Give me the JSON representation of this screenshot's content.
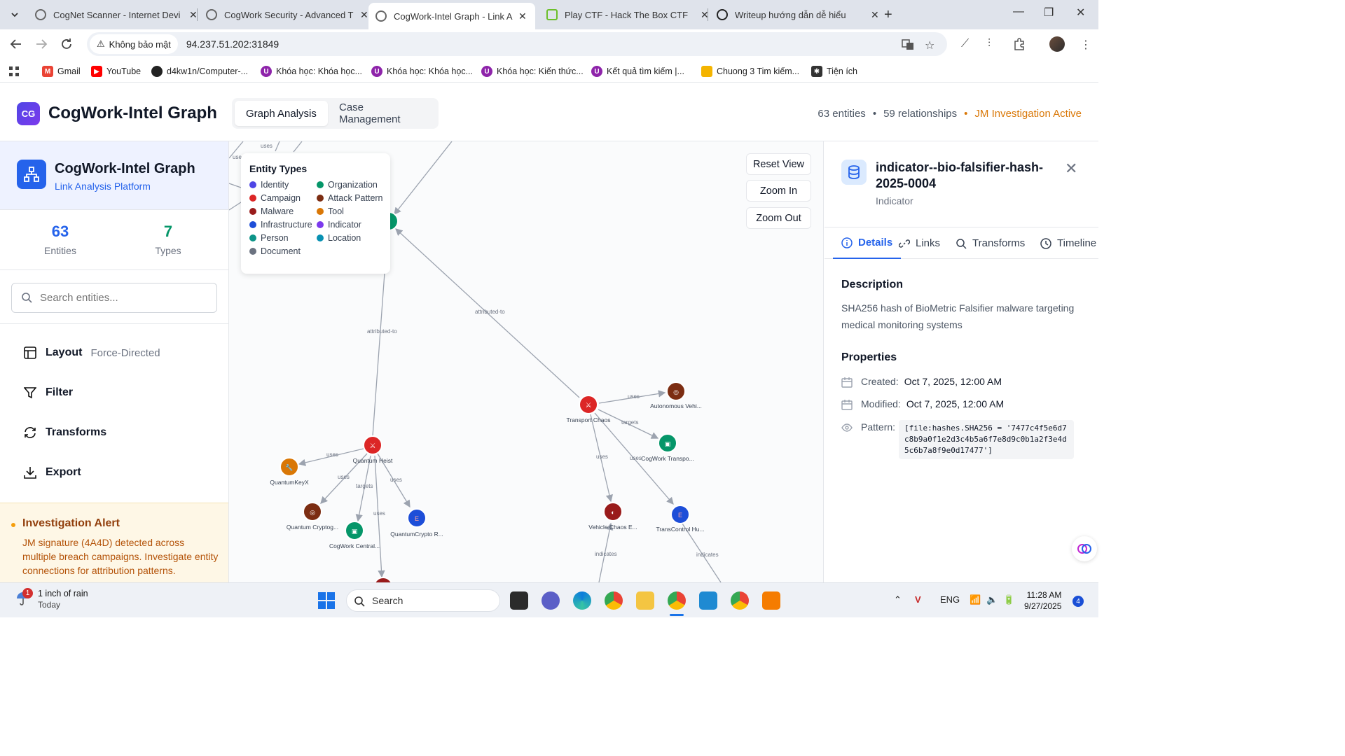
{
  "browser": {
    "tabs": [
      {
        "title": "CogNet Scanner - Internet Devi",
        "active": false
      },
      {
        "title": "CogWork Security - Advanced T",
        "active": false
      },
      {
        "title": "CogWork-Intel Graph - Link An",
        "active": true
      },
      {
        "title": "Play CTF - Hack The Box CTF",
        "active": false
      },
      {
        "title": "Writeup hướng dẫn dễ hiểu",
        "active": false
      }
    ],
    "security_label": "Không bảo mật",
    "url": "94.237.51.202:31849",
    "bookmarks": [
      {
        "label": "Gmail",
        "color": "#ea4335"
      },
      {
        "label": "YouTube",
        "color": "#ff0000"
      },
      {
        "label": "d4kw1n/Computer-...",
        "color": "#222222"
      },
      {
        "label": "Khóa học: Khóa học...",
        "color": "#8e24aa"
      },
      {
        "label": "Khóa học: Khóa học...",
        "color": "#8e24aa"
      },
      {
        "label": "Khóa học: Kiến thức...",
        "color": "#8e24aa"
      },
      {
        "label": "Kết quả tìm kiếm |...",
        "color": "#8e24aa"
      },
      {
        "label": "Chuong 3 Tim kiếm...",
        "color": "#f4b400"
      },
      {
        "label": "Tiện ích",
        "color": "#333333"
      }
    ]
  },
  "app": {
    "logo_text": "CG",
    "title": "CogWork-Intel Graph",
    "tabs": [
      "Graph Analysis",
      "Case Management"
    ],
    "stats": {
      "entities": "63 entities",
      "relationships": "59 relationships",
      "case": "JM Investigation Active"
    }
  },
  "sidebar": {
    "title": "CogWork-Intel Graph",
    "subtitle": "Link Analysis Platform",
    "entities_count": "63",
    "entities_label": "Entities",
    "types_count": "7",
    "types_label": "Types",
    "search_placeholder": "Search entities...",
    "menu": [
      {
        "label": "Layout",
        "sub": "Force-Directed"
      },
      {
        "label": "Filter",
        "sub": ""
      },
      {
        "label": "Transforms",
        "sub": ""
      },
      {
        "label": "Export",
        "sub": ""
      }
    ],
    "alert": {
      "title": "Investigation Alert",
      "body": "JM signature (4A4D) detected across multiple breach campaigns. Investigate entity connections for attribution patterns."
    }
  },
  "graph": {
    "legend_title": "Entity Types",
    "legend": [
      {
        "label": "Identity",
        "color": "#4f46e5"
      },
      {
        "label": "Organization",
        "color": "#059669"
      },
      {
        "label": "Campaign",
        "color": "#dc2626"
      },
      {
        "label": "Attack Pattern",
        "color": "#7c2d12"
      },
      {
        "label": "Malware",
        "color": "#991b1b"
      },
      {
        "label": "Tool",
        "color": "#d97706"
      },
      {
        "label": "Infrastructure",
        "color": "#1d4ed8"
      },
      {
        "label": "Indicator",
        "color": "#7c3aed"
      },
      {
        "label": "Person",
        "color": "#0d9488"
      },
      {
        "label": "Location",
        "color": "#0891b2"
      },
      {
        "label": "Document",
        "color": "#6b7280"
      }
    ],
    "controls": [
      "Reset View",
      "Zoom In",
      "Zoom Out"
    ],
    "node_labels": {
      "transport_chaos": "Transport Chaos",
      "autonomous": "Autonomous Vehi...",
      "cogwork_transpo": "CogWork Transpo...",
      "vehicle_chaos": "Vehicle Chaos E...",
      "transcontrol": "TransControl Hu...",
      "quantum_heist": "Quantum Heist",
      "quantumkeyx": "QuantumKeyX",
      "quantum_crypto": "Quantum Cryptog...",
      "cogwork_central": "CogWork Central...",
      "quantumcrypto_r": "QuantumCrypto R..."
    },
    "edge_labels": {
      "uses": "uses",
      "targets": "targets",
      "attributed_to": "attributed-to",
      "indicates": "indicates"
    }
  },
  "details": {
    "title": "indicator--bio-falsifier-hash-2025-0004",
    "type": "Indicator",
    "tabs": [
      "Details",
      "Links",
      "Transforms",
      "Timeline"
    ],
    "description_heading": "Description",
    "description": "SHA256 hash of BioMetric Falsifier malware targeting medical monitoring systems",
    "properties_heading": "Properties",
    "created_label": "Created:",
    "created": "Oct 7, 2025, 12:00 AM",
    "modified_label": "Modified:",
    "modified": "Oct 7, 2025, 12:00 AM",
    "pattern_label": "Pattern:",
    "pattern": "[file:hashes.SHA256 = '7477c4f5e6d7c8b9a0f1e2d3c4b5a6f7e8d9c0b1a2f3e4d5c6b7a8f9e0d17477']"
  },
  "taskbar": {
    "weather_badge": "1",
    "weather_line1": "1 inch of rain",
    "weather_line2": "Today",
    "search_label": "Search",
    "lang": "ENG",
    "time": "11:28 AM",
    "date": "9/27/2025",
    "notif_count": "4"
  }
}
